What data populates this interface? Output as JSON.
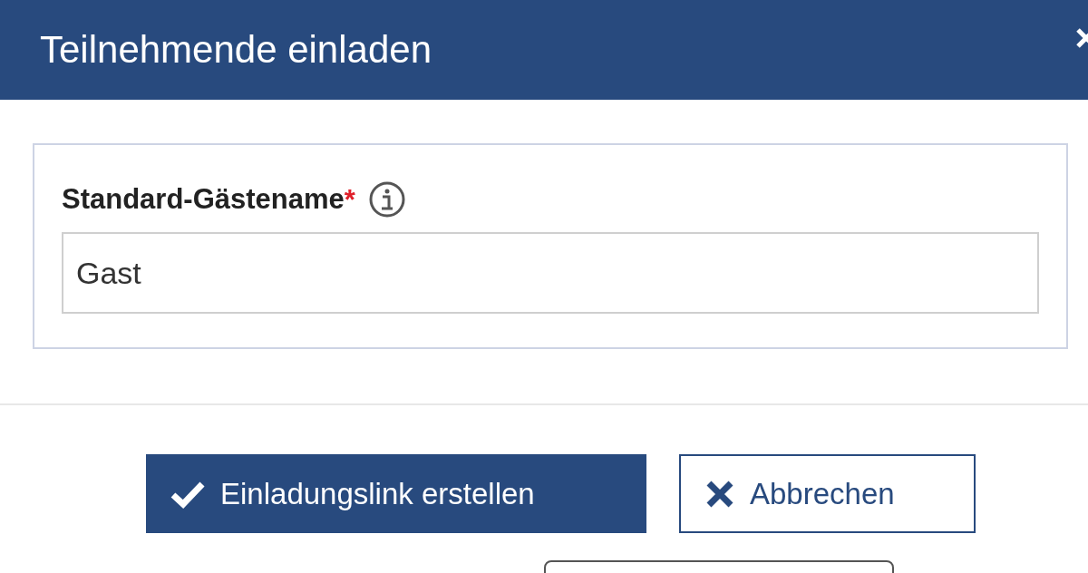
{
  "dialog": {
    "title": "Teilnehmende einladen"
  },
  "field": {
    "label": "Standard-Gästename",
    "required_mark": "*",
    "value": "Gast"
  },
  "buttons": [
    {
      "label": "Einladungslink erstellen",
      "kind": "primary"
    },
    {
      "label": "Abbrechen",
      "kind": "secondary"
    }
  ]
}
